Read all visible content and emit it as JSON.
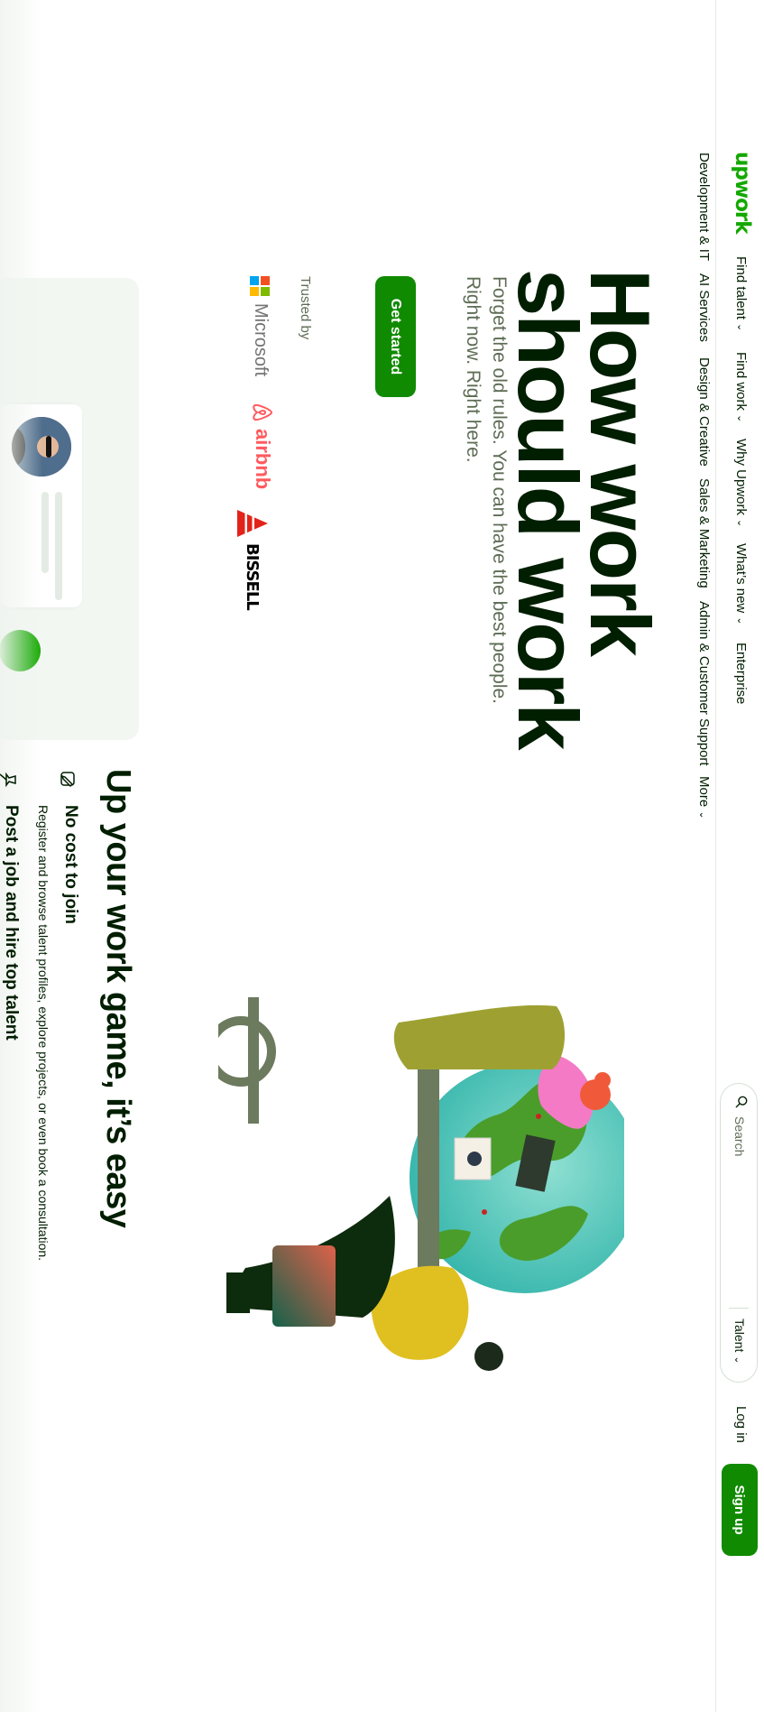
{
  "header": {
    "logo": "upwork",
    "nav": [
      "Find talent",
      "Find work",
      "Why Upwork",
      "What’s new",
      "Enterprise"
    ],
    "search_placeholder": "Search",
    "search_scope": "Talent",
    "login_label": "Log in",
    "signup_label": "Sign up"
  },
  "categories": [
    "Development & IT",
    "AI Services",
    "Design & Creative",
    "Sales & Marketing",
    "Admin & Customer Support",
    "More"
  ],
  "hero": {
    "title_line1": "How work",
    "title_line2": "should work",
    "subtitle": "Forget the old rules. You can have the best people. Right now. Right here.",
    "cta_label": "Get started",
    "trusted_by_label": "Trusted by",
    "logos": [
      "Microsoft",
      "airbnb",
      "BISSELL"
    ]
  },
  "steps": {
    "title": "Up your work game, it’s easy",
    "items": [
      {
        "title": "No cost to join",
        "description": "Register and browse talent profiles, explore projects, or even book a consultation."
      },
      {
        "title": "Post a job and hire top talent"
      }
    ]
  },
  "colors": {
    "brand_green": "#14a800",
    "button_green": "#108a00",
    "text_dark": "#001e00",
    "text_muted": "#5e6d55",
    "panel_bg": "#f2f7f2"
  },
  "icons": [
    "search-icon",
    "chevron-down-icon",
    "pen-icon",
    "pin-icon",
    "airbnb-icon",
    "bissell-icon",
    "microsoft-icon"
  ]
}
